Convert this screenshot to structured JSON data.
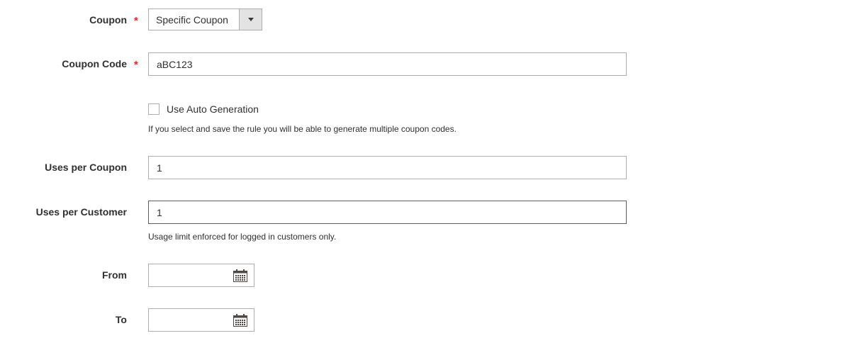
{
  "coupon": {
    "label": "Coupon",
    "required_mark": "*",
    "selected": "Specific Coupon",
    "dropdown_icon": "chevron-down-icon"
  },
  "coupon_code": {
    "label": "Coupon Code",
    "required_mark": "*",
    "value": "aBC123"
  },
  "auto_generation": {
    "label": "Use Auto Generation",
    "checked": false,
    "note": "If you select and save the rule you will be able to generate multiple coupon codes."
  },
  "uses_per_coupon": {
    "label": "Uses per Coupon",
    "value": "1"
  },
  "uses_per_customer": {
    "label": "Uses per Customer",
    "value": "1",
    "note": "Usage limit enforced for logged in customers only."
  },
  "from_date": {
    "label": "From",
    "value": "",
    "icon": "calendar-icon"
  },
  "to_date": {
    "label": "To",
    "value": "",
    "icon": "calendar-icon"
  },
  "colors": {
    "required": "#e22626",
    "focus_border": "#1e7a7a",
    "border": "#adadad",
    "text": "#303030"
  }
}
